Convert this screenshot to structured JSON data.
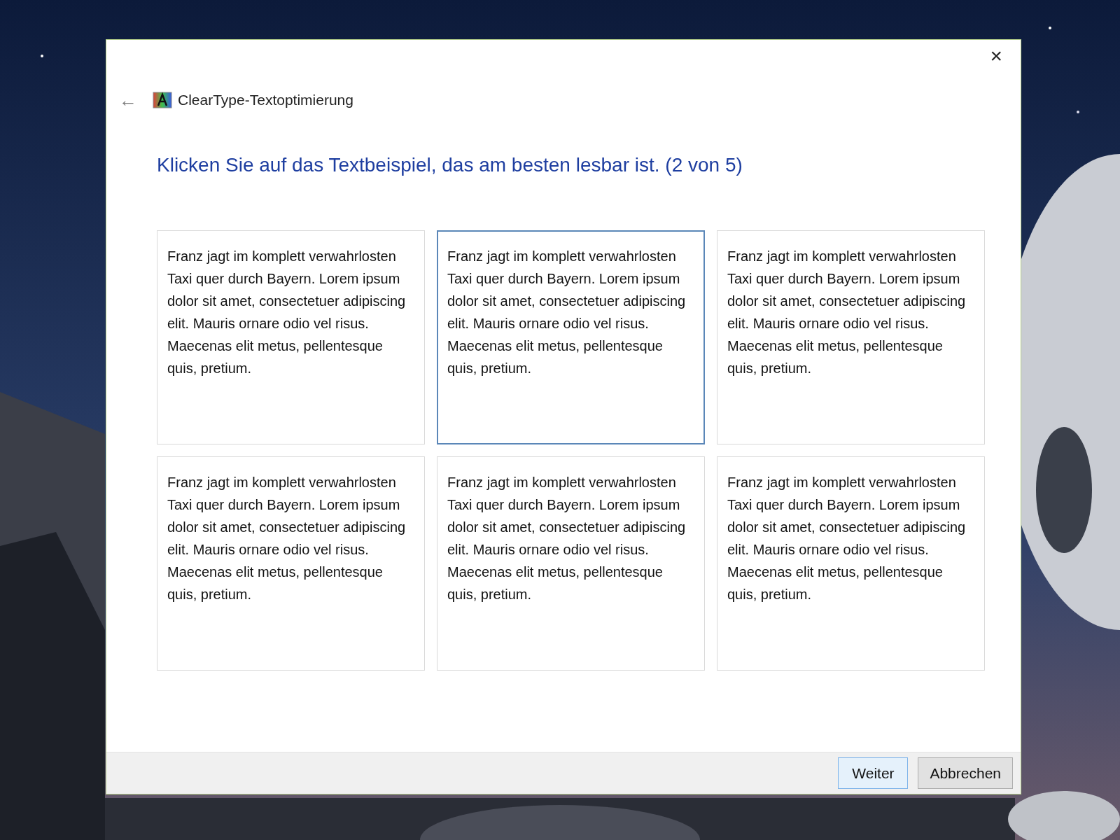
{
  "window": {
    "close": "×",
    "back": "←",
    "title": "ClearType-Textoptimierung"
  },
  "heading": "Klicken Sie auf das Textbeispiel, das am besten lesbar ist. (2 von 5)",
  "samples": [
    {
      "text": "Franz jagt im komplett verwahrlosten Taxi quer durch Bayern. Lorem ipsum dolor sit amet, consectetuer adipiscing elit. Mauris ornare odio vel risus. Maecenas elit metus, pellentesque quis, pretium.",
      "selected": false
    },
    {
      "text": "Franz jagt im komplett verwahrlosten Taxi quer durch Bayern. Lorem ipsum dolor sit amet, consectetuer adipiscing elit. Mauris ornare odio vel risus. Maecenas elit metus, pellentesque quis, pretium.",
      "selected": true
    },
    {
      "text": "Franz jagt im komplett verwahrlosten Taxi quer durch Bayern. Lorem ipsum dolor sit amet, consectetuer adipiscing elit. Mauris ornare odio vel risus. Maecenas elit metus, pellentesque quis, pretium.",
      "selected": false
    },
    {
      "text": "Franz jagt im komplett verwahrlosten Taxi quer durch Bayern. Lorem ipsum dolor sit amet, consectetuer adipiscing elit. Mauris ornare odio vel risus. Maecenas elit metus, pellentesque quis, pretium.",
      "selected": false
    },
    {
      "text": "Franz jagt im komplett verwahrlosten Taxi quer durch Bayern. Lorem ipsum dolor sit amet, consectetuer adipiscing elit. Mauris ornare odio vel risus. Maecenas elit metus, pellentesque quis, pretium.",
      "selected": false
    },
    {
      "text": "Franz jagt im komplett verwahrlosten Taxi quer durch Bayern. Lorem ipsum dolor sit amet, consectetuer adipiscing elit. Mauris ornare odio vel risus. Maecenas elit metus, pellentesque quis, pretium.",
      "selected": false
    }
  ],
  "buttons": [
    {
      "label": "Weiter",
      "kind": "default"
    },
    {
      "label": "Abbrechen",
      "kind": "normal"
    }
  ]
}
